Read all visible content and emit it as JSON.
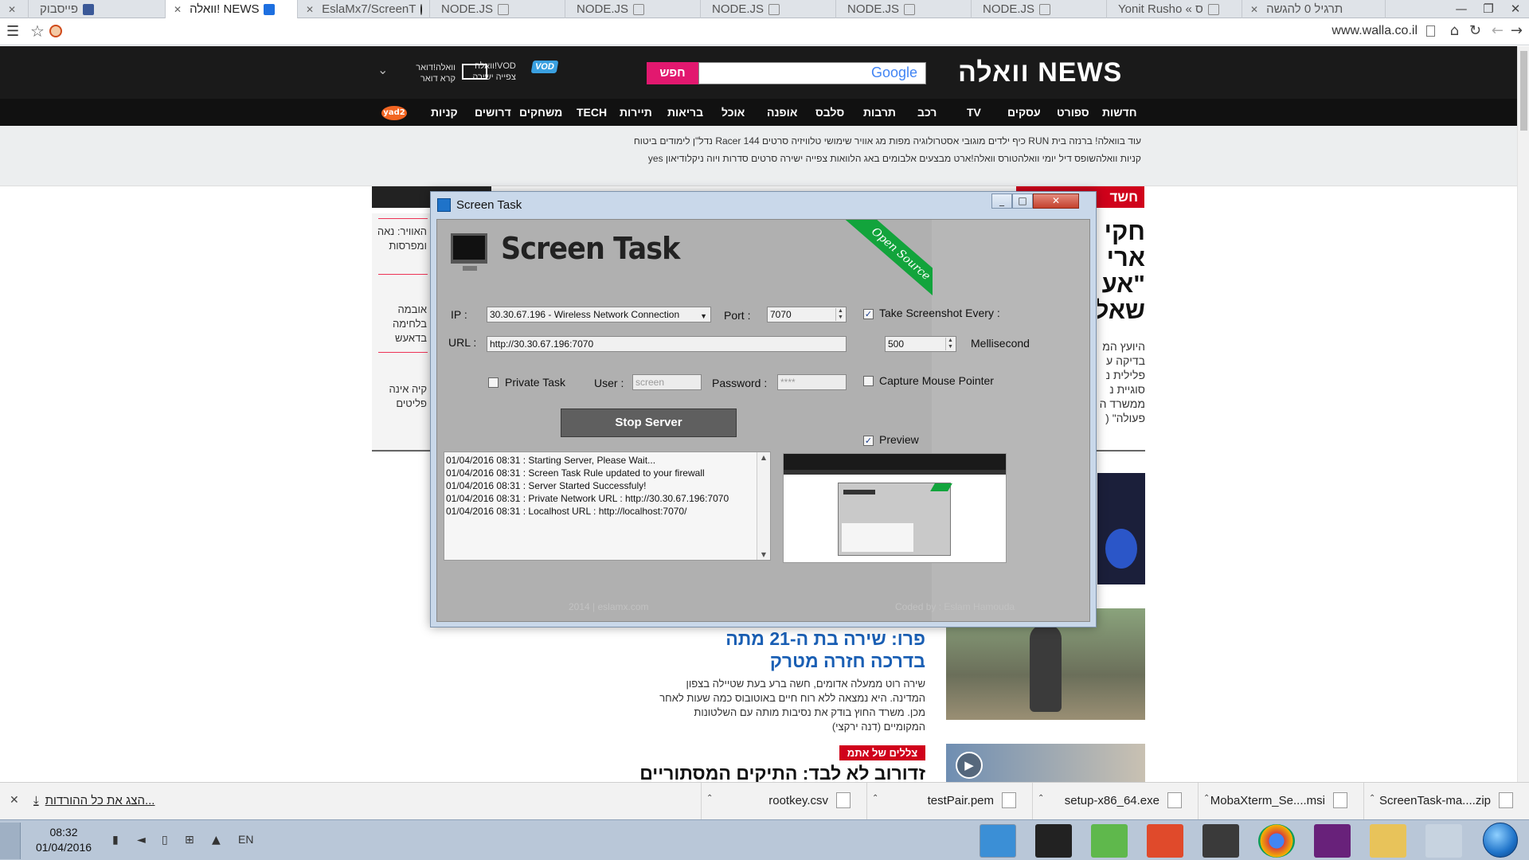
{
  "browser": {
    "tabs": [
      {
        "title": "פייסבוק",
        "icon": "facebook-icon"
      },
      {
        "title": "וואלה! NEWS",
        "icon": "walla-icon"
      },
      {
        "title": "EslaMx7/ScreenT",
        "icon": "github-icon"
      },
      {
        "title": "NODE.JS",
        "icon": "page-icon"
      },
      {
        "title": "NODE.JS",
        "icon": "page-icon"
      },
      {
        "title": "NODE.JS",
        "icon": "page-icon"
      },
      {
        "title": "NODE.JS",
        "icon": "page-icon"
      },
      {
        "title": "NODE.JS",
        "icon": "page-icon"
      },
      {
        "title": "Yonit Rusho « ס",
        "icon": "page-icon"
      },
      {
        "title": "תרגיל 0 להגשה",
        "icon": "page-icon"
      }
    ],
    "url": "www.walla.co.il"
  },
  "walla": {
    "logo": "וואלה NEWS",
    "search_button": "חפש",
    "search_provider": "Google",
    "vod_line1": "וואלה!VOD",
    "vod_line2": "צפייה ישירה",
    "vod_badge": "VOD",
    "mail_line1": "וואלה!דואר",
    "mail_line2": "קרא דואר",
    "nav": [
      "חדשות",
      "ספורט",
      "עסקים",
      "TV",
      "רכב",
      "תרבות",
      "סלבס",
      "אופנה",
      "אוכל",
      "בריאות",
      "תיירות",
      "TECH",
      "משחקים",
      "דרושים",
      "קניות"
    ],
    "nav_badge": "yad2",
    "subnav_line1": "עוד בוואלה!  ברנזה  בית  RUN  כיף  ילדים  מוגוּבי  אסטרולוגיה  מפות  מג אוויר  שימושי  טלוויזיה  סרטים  Racer  144  נדל\"ן  לימודים  ביטוח",
    "subnav_line2": "קניות  וואלהשופס  דיל יומי  וואלהטורס  וואלה!ארט  מבצעים  אלבומים  באג  הלוואות  צפייה ישירה  סרטים  סדרות  ויוה  ניקלודיאון  yes",
    "red_tag": "חשד",
    "headline1": "חקי ארי \"אע שאל",
    "body1": "היועץ המ בדיקה ע פלילית נ סוגיית נ ממשרד ה פעולה\" (",
    "left_items": [
      "האוויר: נאה ומפרסות",
      "אובמה בלחימה בדאעש",
      "קיה אינה פליטים"
    ],
    "headline2": "פרו: שירה בת ה-21 מתה בדרכה חזרה מטרק",
    "body2": "שירה רוט ממעלה אדומים, חשה ברע בעת שטיילה בצפון המדינה. היא נמצאה ללא רוח חיים באוטובוס כמה שעות לאחר מכן. משרד החוץ בודק את נסיבות מותה עם השלטונות המקומיים (דנה ירקצי)",
    "tag2": "צללים של אתמ",
    "headline3": "זדורוב לא לבד: התיקים המסתוריים"
  },
  "screentask": {
    "window_title": "Screen Task",
    "app_title": "Screen Task",
    "ribbon": "Open Source",
    "ip_label": "IP :",
    "ip_value": "30.30.67.196 - Wireless Network Connection",
    "port_label": "Port :",
    "port_value": "7070",
    "url_label": "URL :",
    "url_value": "http://30.30.67.196:7070",
    "private_label": "Private Task",
    "private_checked": false,
    "user_label": "User :",
    "user_value": "screen",
    "password_label": "Password :",
    "password_value": "****",
    "screenshot_label": "Take Screenshot Every :",
    "screenshot_checked": true,
    "interval_value": "500",
    "interval_unit": "Mellisecond",
    "mouse_label": "Capture Mouse Pointer",
    "mouse_checked": false,
    "preview_label": "Preview",
    "preview_checked": true,
    "stop_button": "Stop Server",
    "log": [
      "01/04/2016 08:31 : Starting Server, Please Wait...",
      "01/04/2016 08:31 : Screen Task Rule updated to your firewall",
      "01/04/2016 08:31 : Server Started Successfuly!",
      "01/04/2016 08:31 : Private Network URL : http://30.30.67.196:7070",
      "01/04/2016 08:31 : Localhost URL : http://localhost:7070/"
    ],
    "footer_left": "2014 | eslamx.com",
    "footer_right": "Coded by : Eslam Hamouda"
  },
  "downloads": {
    "show_all": "הצג את כל ההורדות...",
    "items": [
      "ScreenTask-ma....zip",
      "MobaXterm_Se....msi",
      "setup-x86_64.exe",
      "testPair.pem",
      "rootkey.csv"
    ]
  },
  "taskbar": {
    "time": "08:32",
    "date": "01/04/2016",
    "lang": "EN"
  }
}
